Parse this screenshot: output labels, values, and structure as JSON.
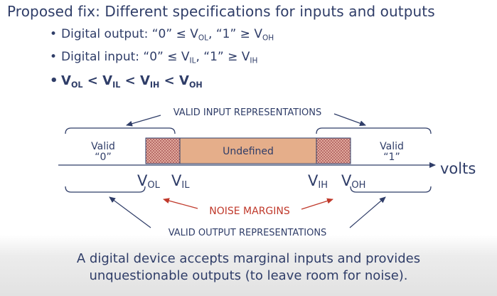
{
  "title": "Proposed fix: Different specifications for inputs and outputs",
  "bullets": [
    {
      "pre": "Digital output: “0” ≤ V",
      "s1": "OL",
      "mid": ", “1” ≥ V",
      "s2": "OH"
    },
    {
      "pre": "Digital input: “0” ≤ V",
      "s1": "IL",
      "mid": ", “1” ≥ V",
      "s2": "IH"
    },
    {
      "v": "V",
      "s1": "OL",
      "lt1": " < V",
      "s2": "IL",
      "lt2": " < V",
      "s3": "IH",
      "lt3": " < V",
      "s4": "OH"
    }
  ],
  "diagram": {
    "valid_input": "VALID INPUT REPRESENTATIONS",
    "valid0_line1": "Valid",
    "valid0_line2": "“0”",
    "undefined": "Undefined",
    "valid1_line1": "Valid",
    "valid1_line2": "“1”",
    "volts": "volts",
    "v_letter": "V",
    "vol_sub": "OL",
    "vil_sub": "IL",
    "vih_sub": "IH",
    "voh_sub": "OH",
    "noise_margins": "NOISE MARGINS",
    "valid_output": "VALID OUTPUT REPRESENTATIONS",
    "colors": {
      "undefined_fill": "#e5ae8a",
      "noise_red": "#c0392b",
      "ink": "#2f3d68"
    }
  },
  "footer_line1": "A digital device accepts marginal inputs and provides",
  "footer_line2": "unquestionable outputs (to leave room for noise)."
}
